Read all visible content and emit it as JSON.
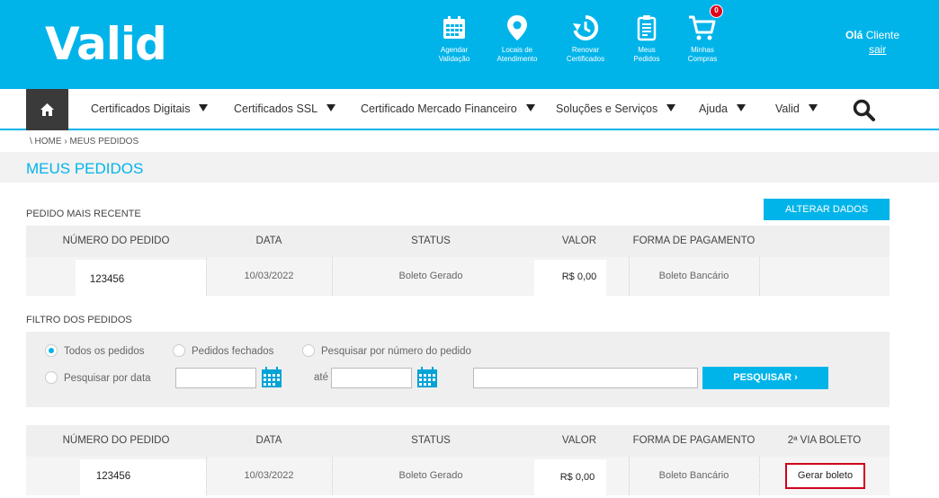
{
  "header": {
    "logo": "Valid",
    "icons": [
      {
        "name": "calendar-icon",
        "label_line1": "Agendar",
        "label_line2": "Validação"
      },
      {
        "name": "location-pin-icon",
        "label_line1": "Locais de",
        "label_line2": "Atendimento"
      },
      {
        "name": "renew-clock-icon",
        "label_line1": "Renovar",
        "label_line2": "Certificados"
      },
      {
        "name": "clipboard-icon",
        "label_line1": "Meus",
        "label_line2": "Pedidos"
      },
      {
        "name": "cart-icon",
        "label_line1": "Minhas",
        "label_line2": "Compras"
      }
    ],
    "cart_count": "0",
    "greeting_bold": "Olá",
    "greeting_name": "Cliente",
    "logout": "sair"
  },
  "nav": {
    "items": [
      "Certificados Digitais",
      "Certificados SSL",
      "Certificado Mercado Financeiro",
      "Soluções e Serviços",
      "Ajuda",
      "Valid"
    ]
  },
  "breadcrumb": "\\ HOME › MEUS PEDIDOS",
  "page_title": "MEUS PEDIDOS",
  "recent": {
    "label": "PEDIDO MAIS RECENTE",
    "button": "ALTERAR DADOS",
    "headers": [
      "NÚMERO DO PEDIDO",
      "DATA",
      "STATUS",
      "VALOR",
      "FORMA DE PAGAMENTO"
    ],
    "row": {
      "numero": "123456",
      "data": "10/03/2022",
      "status": "Boleto Gerado",
      "valor": "R$ 0,00",
      "pagamento": "Boleto Bancário"
    }
  },
  "filter": {
    "label": "FILTRO DOS PEDIDOS",
    "opt_all": "Todos os pedidos",
    "opt_closed": "Pedidos fechados",
    "opt_number": "Pesquisar por número do pedido",
    "opt_date": "Pesquisar por data",
    "until": "até",
    "date_from": "",
    "date_to": "",
    "number_value": "",
    "search_button": "PESQUISAR ›"
  },
  "orders": {
    "headers": [
      "NÚMERO DO PEDIDO",
      "DATA",
      "STATUS",
      "VALOR",
      "FORMA DE PAGAMENTO",
      "2ª VIA BOLETO"
    ],
    "rows": [
      {
        "numero": "123456",
        "data": "10/03/2022",
        "status": "Boleto Gerado",
        "valor": "R$ 0,00",
        "pagamento": "Boleto Bancário",
        "action": "Gerar boleto"
      }
    ]
  }
}
